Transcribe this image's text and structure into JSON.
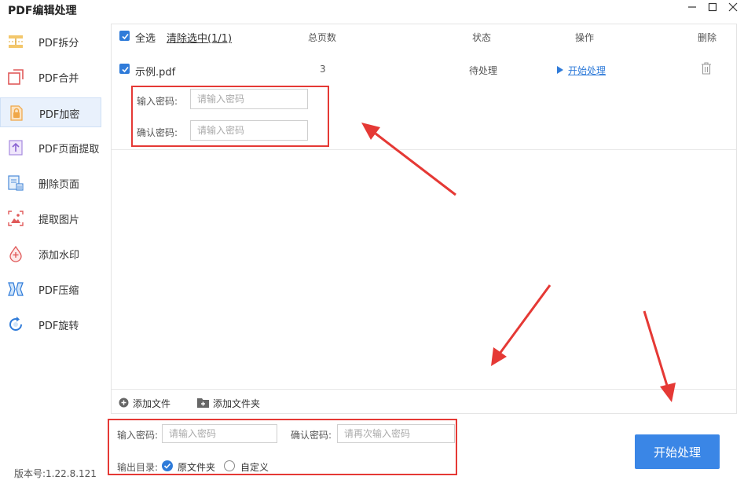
{
  "app": {
    "title": "PDF编辑处理",
    "version": "版本号:1.22.8.121"
  },
  "window": {
    "minimize_icon": "minimize-icon",
    "maximize_icon": "maximize-icon",
    "close_icon": "close-icon"
  },
  "sidebar": {
    "items": [
      {
        "label": "PDF拆分",
        "icon": "split-icon",
        "active": false
      },
      {
        "label": "PDF合并",
        "icon": "merge-icon",
        "active": false
      },
      {
        "label": "PDF加密",
        "icon": "lock-icon",
        "active": true
      },
      {
        "label": "PDF页面提取",
        "icon": "extract-page-icon",
        "active": false
      },
      {
        "label": "删除页面",
        "icon": "delete-page-icon",
        "active": false
      },
      {
        "label": "提取图片",
        "icon": "extract-image-icon",
        "active": false
      },
      {
        "label": "添加水印",
        "icon": "watermark-icon",
        "active": false
      },
      {
        "label": "PDF压缩",
        "icon": "compress-icon",
        "active": false
      },
      {
        "label": "PDF旋转",
        "icon": "rotate-icon",
        "active": false
      }
    ]
  },
  "table": {
    "select_all": "全选",
    "clear_selection": "清除选中(1/1)",
    "columns": {
      "pages": "总页数",
      "status": "状态",
      "action": "操作",
      "delete": "删除"
    },
    "rows": [
      {
        "name": "示例.pdf",
        "pages": "3",
        "status": "待处理",
        "action": "开始处理",
        "password_label": "输入密码:",
        "password_placeholder": "请输入密码",
        "confirm_label": "确认密码:",
        "confirm_placeholder": "请输入密码"
      }
    ]
  },
  "footer": {
    "add_file": "添加文件",
    "add_folder": "添加文件夹"
  },
  "settings": {
    "password_label": "输入密码:",
    "password_placeholder": "请输入密码",
    "confirm_label": "确认密码:",
    "confirm_placeholder": "请再次输入密码",
    "output_label": "输出目录:",
    "output_options": [
      {
        "label": "原文件夹",
        "selected": true
      },
      {
        "label": "自定义",
        "selected": false
      }
    ],
    "start_button": "开始处理"
  },
  "colors": {
    "accent": "#2f7bd9",
    "button": "#3a86e6",
    "annotation": "#e53935"
  }
}
